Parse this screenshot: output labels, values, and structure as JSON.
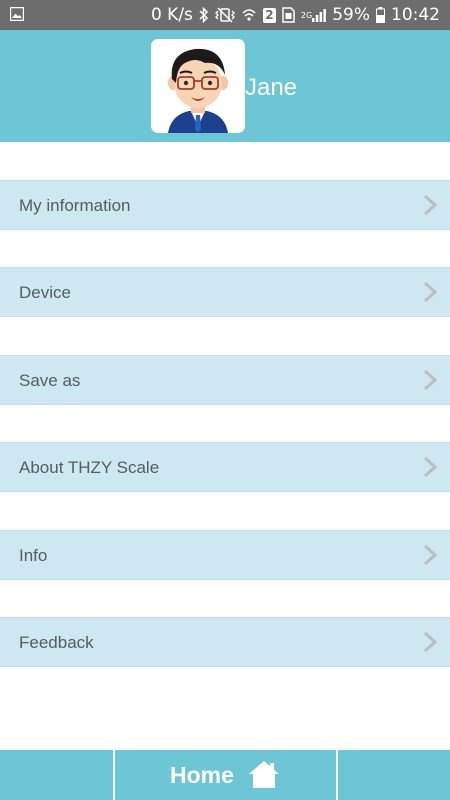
{
  "status_bar": {
    "speed": "0 K/s",
    "sim_slot": "2",
    "network_type": "2G",
    "battery": "59%",
    "time": "10:42"
  },
  "profile": {
    "name": "Jane",
    "avatar_icon": "cartoon-man-with-glasses-avatar"
  },
  "menu": {
    "items": [
      {
        "label": "My information"
      },
      {
        "label": "Device"
      },
      {
        "label": "Save as"
      },
      {
        "label": "About THZY Scale"
      },
      {
        "label": "Info"
      },
      {
        "label": "Feedback"
      }
    ]
  },
  "bottom_nav": {
    "home_label": "Home",
    "home_icon": "house-icon"
  },
  "colors": {
    "accent": "#6cc6d6",
    "menu_row": "#cde8f0",
    "status_bar": "#6d6d6d"
  }
}
